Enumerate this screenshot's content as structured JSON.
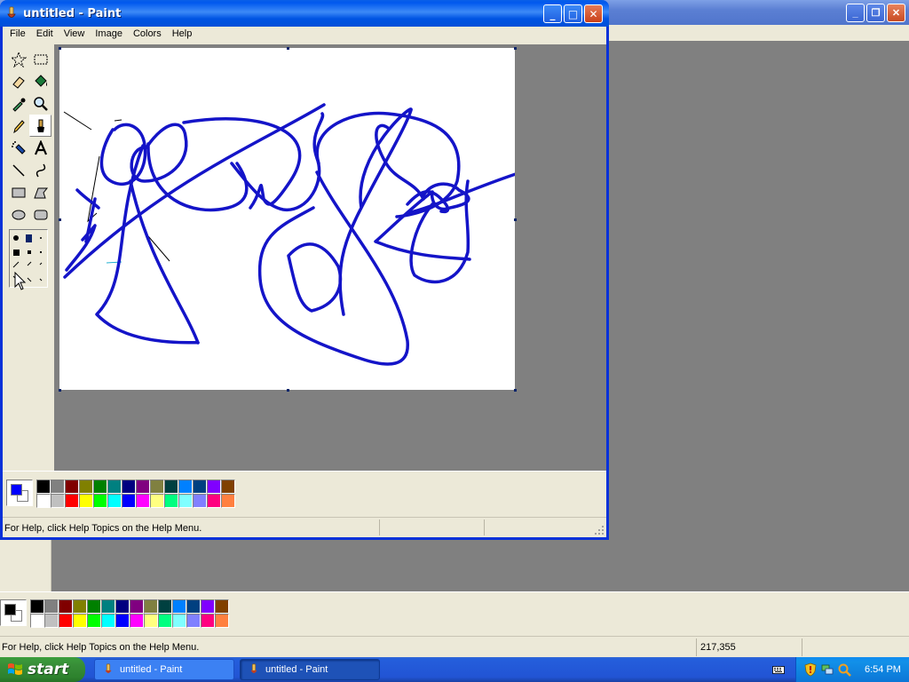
{
  "background_window": {
    "controls": {
      "minimize": "_",
      "restore": "❐",
      "close": "✕"
    },
    "status": {
      "help": "For Help, click Help Topics on the Help Menu.",
      "coords": "217,355"
    }
  },
  "window": {
    "title": "untitled - Paint",
    "controls": {
      "minimize": "_",
      "maximize": "□",
      "close": "✕"
    },
    "menu": [
      "File",
      "Edit",
      "View",
      "Image",
      "Colors",
      "Help"
    ],
    "status": {
      "help": "For Help, click Help Topics on the Help Menu."
    },
    "foreground_color": "#0000FF",
    "background_color": "#FFFFFF",
    "brush_color": "#1414C8"
  },
  "background_palette_fg": "#000000",
  "palette": [
    "#000000",
    "#808080",
    "#800000",
    "#808000",
    "#008000",
    "#008080",
    "#000080",
    "#800080",
    "#808040",
    "#004040",
    "#0080FF",
    "#004080",
    "#8000FF",
    "#804000",
    "#FFFFFF",
    "#C0C0C0",
    "#FF0000",
    "#FFFF00",
    "#00FF00",
    "#00FFFF",
    "#0000FF",
    "#FF00FF",
    "#FFFF80",
    "#00FF80",
    "#80FFFF",
    "#8080FF",
    "#FF0080",
    "#FF8040"
  ],
  "tools": [
    "free-form-select",
    "select",
    "eraser",
    "fill-with-color",
    "pick-color",
    "magnifier",
    "pencil",
    "brush",
    "airbrush",
    "text",
    "line",
    "curve",
    "rectangle",
    "polygon",
    "ellipse",
    "rounded-rectangle"
  ],
  "active_tool": "brush",
  "taskbar": {
    "start": "start",
    "tasks": [
      "untitled - Paint",
      "untitled - Paint"
    ],
    "clock": "6:54 PM"
  }
}
